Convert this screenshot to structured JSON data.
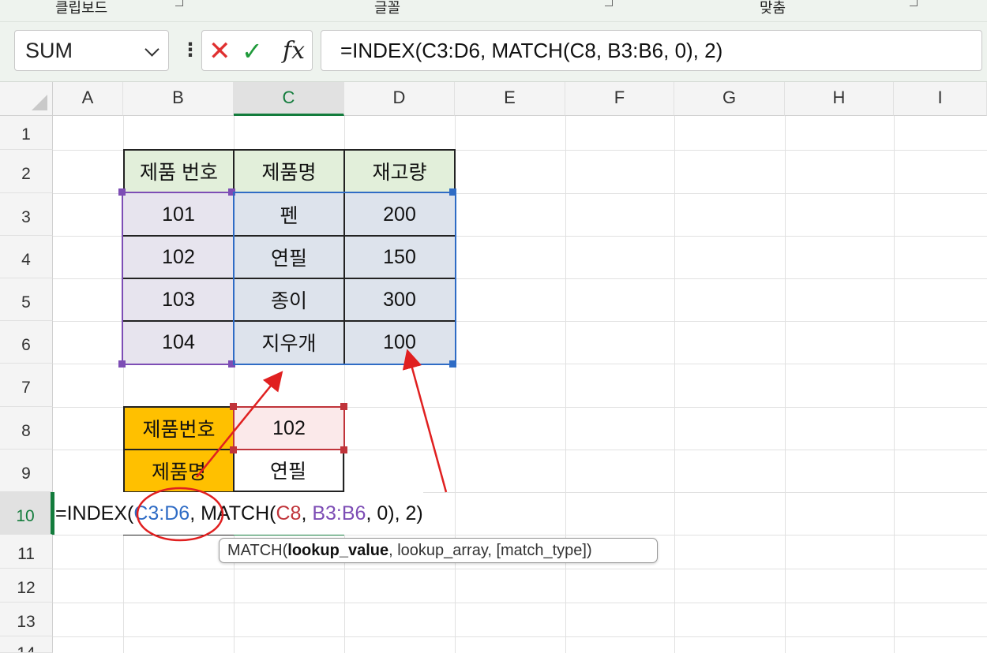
{
  "ribbon": {
    "groups": [
      "클립보드",
      "글꼴",
      "맞춤"
    ]
  },
  "formula_bar": {
    "name_box_value": "SUM",
    "cancel_symbol": "✕",
    "enter_symbol": "✓",
    "fx_label": "fx",
    "formula": "=INDEX(C3:D6, MATCH(C8, B3:B6, 0), 2)"
  },
  "columns": [
    "A",
    "B",
    "C",
    "D",
    "E",
    "F",
    "G",
    "H",
    "I"
  ],
  "active_column": "C",
  "rows": [
    "1",
    "2",
    "3",
    "4",
    "5",
    "6",
    "7",
    "8",
    "9",
    "10",
    "11",
    "12",
    "13",
    "14"
  ],
  "active_row": "10",
  "table": {
    "headers": [
      "제품 번호",
      "제품명",
      "재고량"
    ],
    "rows": [
      [
        "101",
        "펜",
        "200"
      ],
      [
        "102",
        "연필",
        "150"
      ],
      [
        "103",
        "종이",
        "300"
      ],
      [
        "104",
        "지우개",
        "100"
      ]
    ]
  },
  "lookup": {
    "label_number": "제품번호",
    "value_number": "102",
    "label_name": "제품명",
    "value_name": "연필"
  },
  "edit": {
    "prefix": "=INDEX(",
    "ref_range": "C3:D6",
    "sep1": ", MATCH(",
    "ref_cell": "C8",
    "sep2": ", ",
    "ref_lookup": "B3:B6",
    "suffix": ", 0), 2)"
  },
  "tooltip": {
    "func": "MATCH(",
    "arg_bold": "lookup_value",
    "rest": ", lookup_array, [match_type])"
  },
  "colors": {
    "accent_green": "#137c3c",
    "ref_blue": "#2f6cc5",
    "ref_red": "#c0343a",
    "ref_purple": "#7d4db5",
    "annotation_red": "#e02020",
    "orange_fill": "#ffc000",
    "header_fill": "#e2efda"
  },
  "icons": {
    "name_box_dropdown": "chevron-down-icon",
    "more": "kebab-icon",
    "cancel": "close-icon",
    "enter": "check-icon",
    "function": "fx-icon"
  }
}
